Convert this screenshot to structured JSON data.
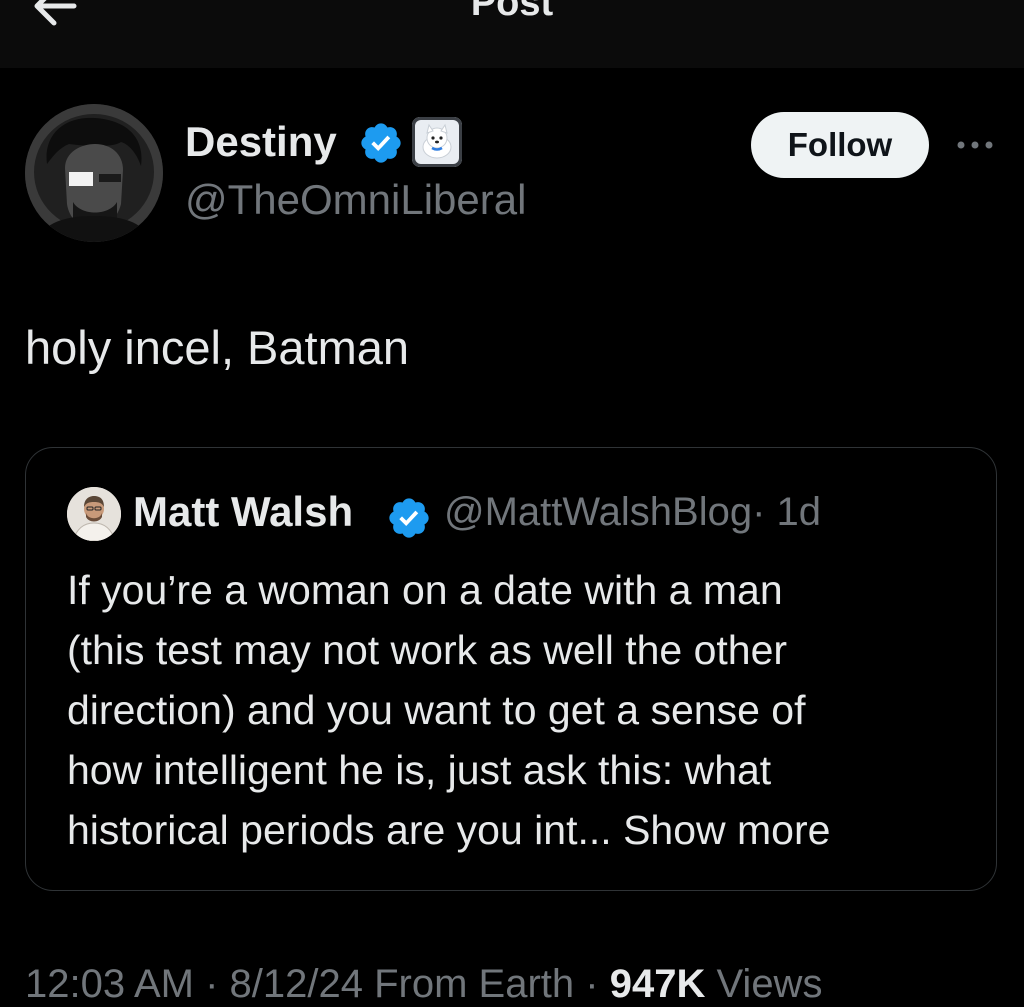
{
  "header": {
    "title": "Post",
    "back_icon": "arrow-left-icon"
  },
  "post": {
    "author": {
      "name": "Destiny",
      "handle": "@TheOmniLiberal",
      "verified": true,
      "affiliate_badge": "white-dog-icon"
    },
    "follow_label": "Follow",
    "more_icon": "ellipsis-icon",
    "text": "holy incel, Batman"
  },
  "quote": {
    "author": {
      "name": "Matt Walsh",
      "handle": "@MattWalshBlog",
      "time": "· 1d",
      "verified": true
    },
    "lines": [
      "If you’re a woman on a date with a man",
      "(this test may not work as well the other",
      "direction) and you want to get a sense of",
      "how intelligent he is, just ask this: what",
      "historical periods are you int..."
    ],
    "show_more": "Show more"
  },
  "meta": {
    "time_date": "12:03 AM · 8/12/24 From Earth ·",
    "views_count": "947K",
    "views_label": "Views"
  },
  "colors": {
    "background": "#000000",
    "text_primary": "#e7e9ea",
    "text_secondary": "#71767b",
    "verified_blue": "#1d9bf0",
    "follow_bg": "#eff3f4",
    "border": "#2f3336"
  }
}
